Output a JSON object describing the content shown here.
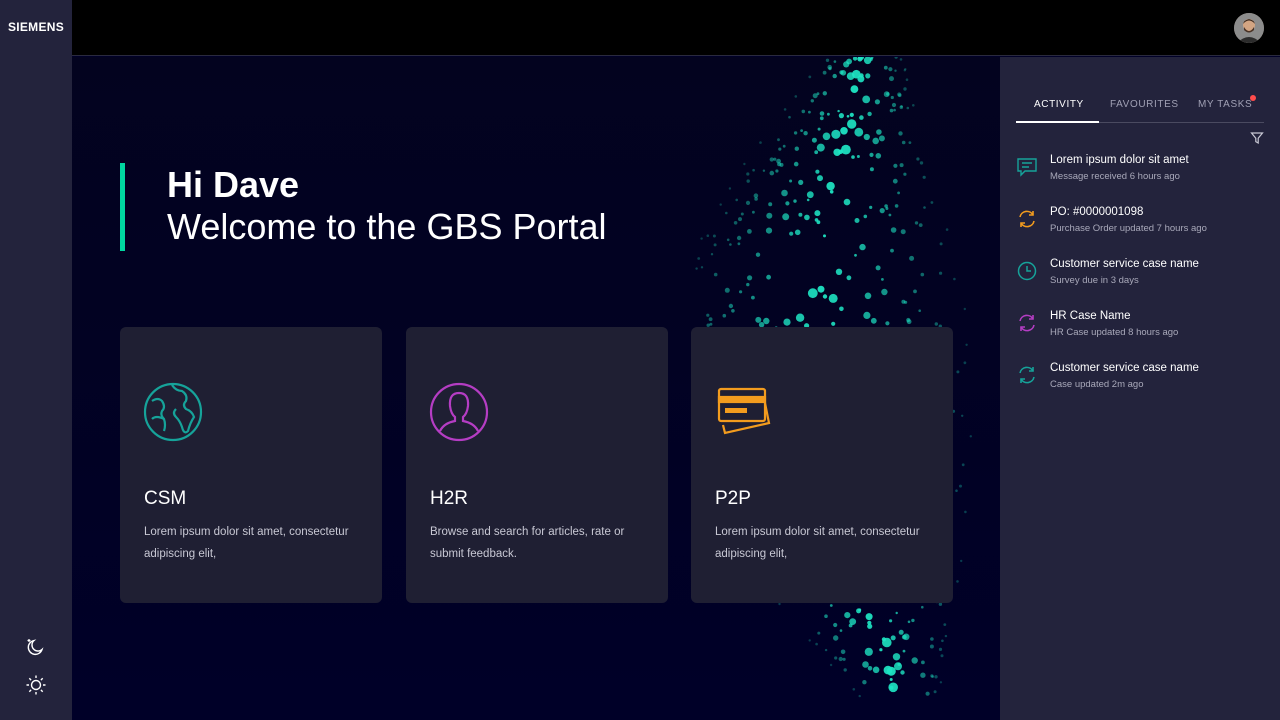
{
  "brand": {
    "logo_text": "SIEMENS"
  },
  "rail": {
    "dark_mode_icon": "moon-icon",
    "light_mode_icon": "sun-icon"
  },
  "header": {
    "avatar_icon": "user-avatar"
  },
  "welcome": {
    "greeting": "Hi Dave",
    "subtitle": "Welcome to the GBS Portal",
    "accent_color": "#00d7a0"
  },
  "cards": [
    {
      "title": "CSM",
      "description": "Lorem ipsum dolor sit amet, consectetur adipiscing elit,",
      "icon": "globe-icon",
      "color": "#16a39a"
    },
    {
      "title": "H2R",
      "description": "Browse and search for articles, rate or submit feedback.",
      "icon": "person-icon",
      "color": "#b53dc4"
    },
    {
      "title": "P2P",
      "description": "Lorem ipsum dolor sit amet, consectetur adipiscing elit,",
      "icon": "credit-card-icon",
      "color": "#f39c1e"
    }
  ],
  "panel": {
    "tabs": [
      {
        "label": "ACTIVITY",
        "active": true
      },
      {
        "label": "FAVOURITES",
        "active": false
      },
      {
        "label": "MY TASKS",
        "active": false,
        "has_notification": true
      }
    ],
    "filter_icon": "filter-icon",
    "activities": [
      {
        "title": "Lorem ipsum dolor sit amet",
        "meta": "Message received 6 hours ago",
        "icon": "message-icon",
        "color": "#16a39a"
      },
      {
        "title": "PO: #0000001098",
        "meta": "Purchase Order updated 7 hours ago",
        "icon": "sync-icon",
        "color": "#f39c1e"
      },
      {
        "title": "Customer service case name",
        "meta": "Survey due in 3 days",
        "icon": "clock-icon",
        "color": "#16a39a"
      },
      {
        "title": "HR Case Name",
        "meta": "HR Case updated 8 hours ago",
        "icon": "sync-icon",
        "color": "#b53dc4"
      },
      {
        "title": "Customer service case name",
        "meta": "Case updated 2m ago",
        "icon": "sync-icon",
        "color": "#16a39a"
      }
    ]
  },
  "colors": {
    "background": "#000028",
    "rail": "#23233c",
    "card": "#1f1f33",
    "notification": "#ff4c4c"
  }
}
